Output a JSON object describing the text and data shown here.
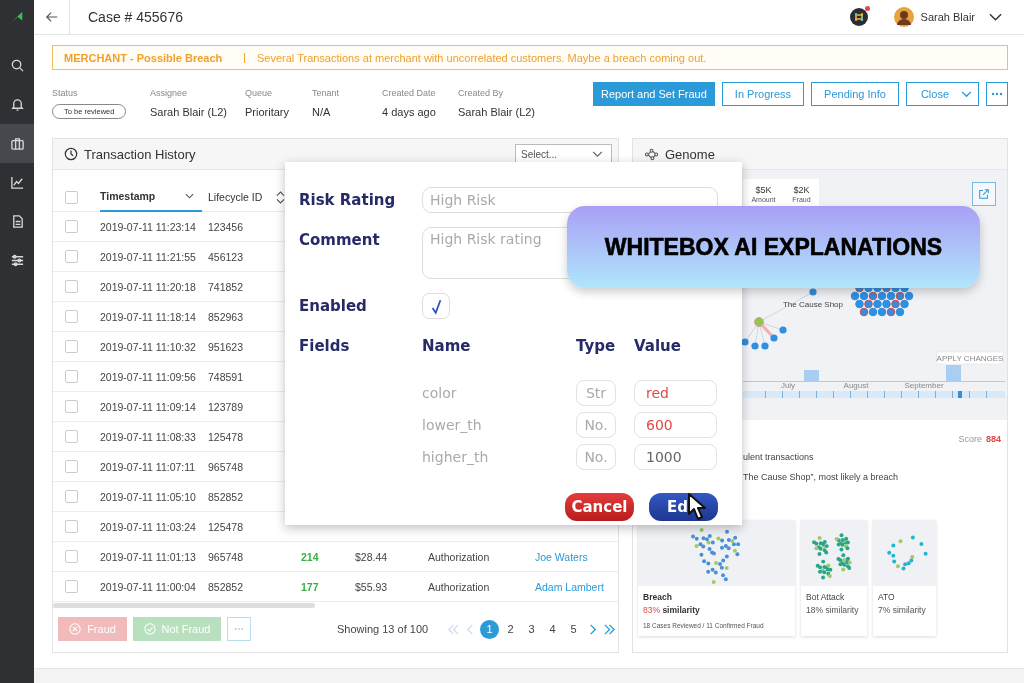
{
  "sidebar": {
    "items": [
      {
        "kind": "search",
        "selected": false
      },
      {
        "kind": "bell",
        "selected": false
      },
      {
        "kind": "briefcase",
        "selected": true
      },
      {
        "kind": "chart",
        "selected": false
      },
      {
        "kind": "document",
        "selected": false
      },
      {
        "kind": "sliders",
        "selected": false
      }
    ]
  },
  "header": {
    "title": "Case # 455676",
    "user": "Sarah Blair",
    "notification": true
  },
  "alert": {
    "title": "MERCHANT - Possible Breach",
    "message": "Several Transactions at merchant with uncorrelated customers. Maybe a breach coming out."
  },
  "details": [
    {
      "label": "Status",
      "value": "To be reviewed",
      "kind": "badge"
    },
    {
      "label": "Assignee",
      "value": "Sarah Blair (L2)",
      "kind": "text"
    },
    {
      "label": "Queue",
      "value": "Prioritary",
      "kind": "text"
    },
    {
      "label": "Tenant",
      "value": "N/A",
      "kind": "text"
    },
    {
      "label": "Created Date",
      "value": "4 days ago",
      "kind": "text"
    },
    {
      "label": "Created By",
      "value": "Sarah Blair (L2)",
      "kind": "text"
    }
  ],
  "actions": [
    {
      "label": "Report and Set Fraud",
      "kind": "primary"
    },
    {
      "label": "In Progress",
      "kind": "outline"
    },
    {
      "label": "Pending Info",
      "kind": "outline"
    },
    {
      "label": "Close",
      "kind": "dropdown"
    }
  ],
  "transactions": {
    "title": "Transaction History",
    "filter": {
      "placeholder": "Select..."
    },
    "header_checked": false,
    "columns": [
      {
        "label": "Timestamp",
        "sorted": true
      },
      {
        "label": "Lifecycle ID",
        "sorted": false
      }
    ],
    "rows": [
      {
        "timestamp": "2019-07-11 11:23:14",
        "id": "123456",
        "checked": false
      },
      {
        "timestamp": "2019-07-11 11:21:55",
        "id": "456123",
        "checked": false
      },
      {
        "timestamp": "2019-07-11 11:20:18",
        "id": "741852",
        "checked": false
      },
      {
        "timestamp": "2019-07-11 11:18:14",
        "id": "852963",
        "checked": false
      },
      {
        "timestamp": "2019-07-11 11:10:32",
        "id": "951623",
        "checked": false
      },
      {
        "timestamp": "2019-07-11 11:09:56",
        "id": "748591",
        "checked": false
      },
      {
        "timestamp": "2019-07-11 11:09:14",
        "id": "123789",
        "checked": false
      },
      {
        "timestamp": "2019-07-11 11:08:33",
        "id": "125478",
        "checked": false
      },
      {
        "timestamp": "2019-07-11 11:07:11",
        "id": "965748",
        "checked": false
      },
      {
        "timestamp": "2019-07-11 11:05:10",
        "id": "852852",
        "checked": false
      },
      {
        "timestamp": "2019-07-11 11:03:24",
        "id": "125478",
        "checked": false
      },
      {
        "timestamp": "2019-07-11 11:01:13",
        "id": "965748",
        "checked": false,
        "score": "214",
        "amount": "$28.44",
        "type": "Authorization",
        "customer": "Joe Waters"
      },
      {
        "timestamp": "2019-07-11 11:00:04",
        "id": "852852",
        "checked": false,
        "score": "177",
        "amount": "$55.93",
        "type": "Authorization",
        "customer": "Adam Lambert"
      }
    ],
    "buttons": [
      {
        "kind": "fraud",
        "label": "Fraud",
        "disabled": true
      },
      {
        "kind": "not_fraud",
        "label": "Not Fraud",
        "disabled": true
      }
    ],
    "showing": "Showing 13 of 100",
    "nav_back": [
      {
        "kind": "first",
        "disabled": true
      },
      {
        "kind": "prev",
        "disabled": true
      }
    ],
    "pages": [
      {
        "label": "1",
        "selected": true
      },
      {
        "label": "2",
        "selected": false
      },
      {
        "label": "3",
        "selected": false
      },
      {
        "label": "4",
        "selected": false
      },
      {
        "label": "5",
        "selected": false
      }
    ],
    "nav_forward": [
      {
        "kind": "next",
        "disabled": false
      },
      {
        "kind": "last",
        "disabled": false
      }
    ]
  },
  "genome": {
    "title": "Genome",
    "stats": [
      {
        "value": "$5K",
        "label": "Amount"
      },
      {
        "value": "$2K",
        "label": "Fraud"
      }
    ],
    "node_label": "The Cause Shop",
    "apply_label": "APPLY CHANGES",
    "months": [
      "July",
      "August",
      "September"
    ],
    "score_label": "Score",
    "score": "884",
    "findings": [
      "ulent transactions",
      "The Cause Shop”, most likely a breach"
    ],
    "patterns": [
      {
        "kind": "breach",
        "title": "Breach",
        "percent": "83%",
        "similarity": "similarity",
        "highlight": true,
        "note": "18 Cases Reviewed / 11 Confirmed Fraud"
      },
      {
        "kind": "bot",
        "title": "Bot Attack",
        "percent": "18%",
        "similarity": "similarity",
        "highlight": false
      },
      {
        "kind": "ato",
        "title": "ATO",
        "percent": "7%",
        "similarity": "similarity",
        "highlight": false
      }
    ]
  },
  "rule_dialog": {
    "fields": [
      {
        "label": "Risk Rating",
        "placeholder": "High Risk",
        "kind": "input"
      },
      {
        "label": "Comment",
        "placeholder": "High Risk rating",
        "kind": "textarea"
      }
    ],
    "enabled_label": "Enabled",
    "enabled": true,
    "fields_label": "Fields",
    "columns": [
      "Name",
      "Type",
      "Value"
    ],
    "params": [
      {
        "name": "color",
        "type": "Str",
        "value": "red",
        "changed": true
      },
      {
        "name": "lower_th",
        "type": "No.",
        "value": "600",
        "changed": true
      },
      {
        "name": "higher_th",
        "type": "No.",
        "value": "1000",
        "changed": false
      }
    ],
    "cancel": "Cancel",
    "confirm": "Ed"
  },
  "banner": {
    "text": "WHITEBOX AI EXPLANATIONS"
  }
}
